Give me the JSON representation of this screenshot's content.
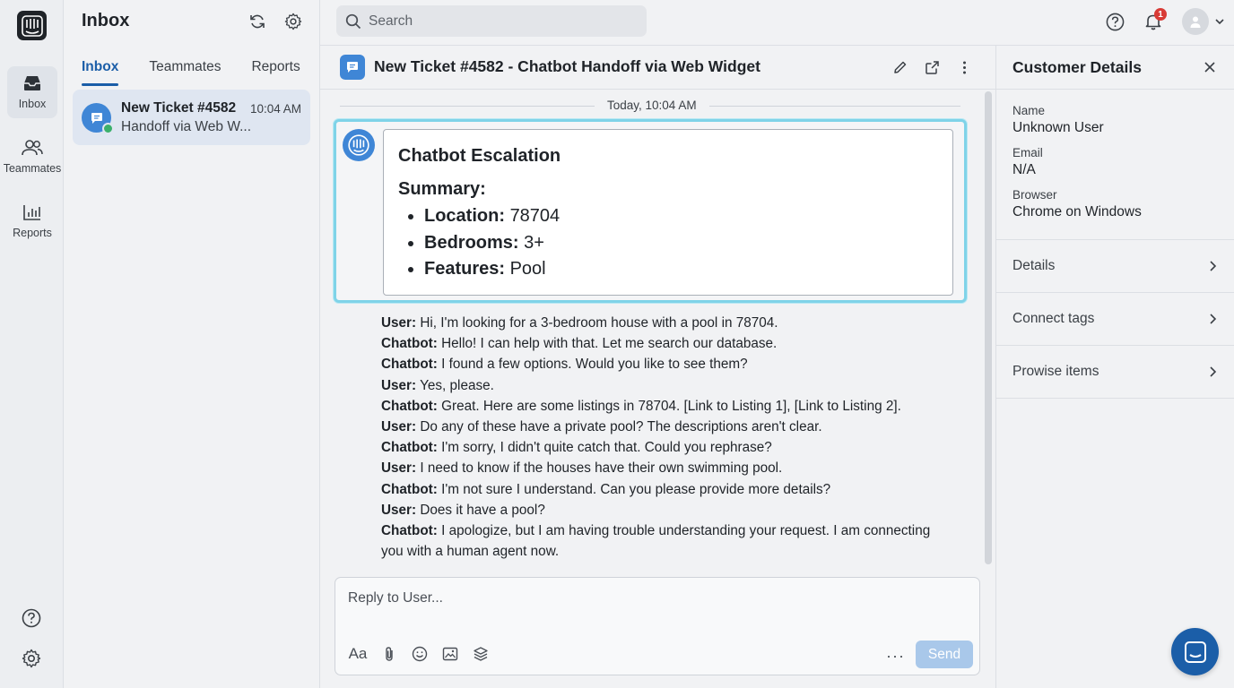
{
  "rail": {
    "items": [
      {
        "label": "Inbox",
        "icon": "inbox-icon",
        "active": true
      },
      {
        "label": "Teammates",
        "icon": "people-icon",
        "active": false
      },
      {
        "label": "Reports",
        "icon": "bar-chart-icon",
        "active": false
      }
    ]
  },
  "inbox": {
    "title": "Inbox",
    "tabs": [
      "Inbox",
      "Teammates",
      "Reports"
    ],
    "conversation": {
      "title": "New Ticket #4582",
      "time": "10:04 AM",
      "preview": "Handoff via Web W..."
    }
  },
  "topbar": {
    "search_placeholder": "Search",
    "notification_count": "1"
  },
  "conversation": {
    "title": "New Ticket #4582 - Chatbot Handoff via Web Widget",
    "date_divider": "Today, 10:04 AM",
    "summary": {
      "title": "Chatbot Escalation",
      "subtitle": "Summary:",
      "items": [
        {
          "key": "Location:",
          "value": "78704"
        },
        {
          "key": "Bedrooms:",
          "value": "3+"
        },
        {
          "key": "Features:",
          "value": "Pool"
        }
      ]
    },
    "transcript": [
      {
        "speaker": "User:",
        "text": "Hi, I'm looking for a 3-bedroom house with a pool in 78704."
      },
      {
        "speaker": "Chatbot:",
        "text": "Hello! I can help with that. Let me search our database."
      },
      {
        "speaker": "Chatbot:",
        "text": "I found a few options. Would you like to see them?"
      },
      {
        "speaker": "User:",
        "text": "Yes, please."
      },
      {
        "speaker": "Chatbot:",
        "text": "Great. Here are some listings in 78704. [Link to Listing 1], [Link to Listing 2]."
      },
      {
        "speaker": "User:",
        "text": "Do any of these have a private pool? The descriptions aren't clear."
      },
      {
        "speaker": "Chatbot:",
        "text": "I'm sorry, I didn't quite catch that. Could you rephrase?"
      },
      {
        "speaker": "User:",
        "text": "I need to know if the houses have their own swimming pool."
      },
      {
        "speaker": "Chatbot:",
        "text": "I'm not sure I understand. Can you please provide more details?"
      },
      {
        "speaker": "User:",
        "text": "Does it have a pool?"
      },
      {
        "speaker": "Chatbot:",
        "text": "I apologize, but I am having trouble understanding your request. I am connecting you with a human agent now."
      }
    ]
  },
  "composer": {
    "placeholder": "Reply to User...",
    "format_label": "Aa",
    "more_label": "···",
    "send_label": "Send"
  },
  "details": {
    "title": "Customer Details",
    "fields": [
      {
        "label": "Name",
        "value": "Unknown User"
      },
      {
        "label": "Email",
        "value": "N/A"
      },
      {
        "label": "Browser",
        "value": "Chrome on Windows"
      }
    ],
    "rows": [
      "Details",
      "Connect tags",
      "Prowise items"
    ]
  },
  "colors": {
    "accent": "#1b5ea8",
    "highlight_border": "#7fd3e8",
    "bot_blue": "#3f86d6",
    "online_green": "#3bb06b",
    "badge_red": "#d83b36"
  }
}
